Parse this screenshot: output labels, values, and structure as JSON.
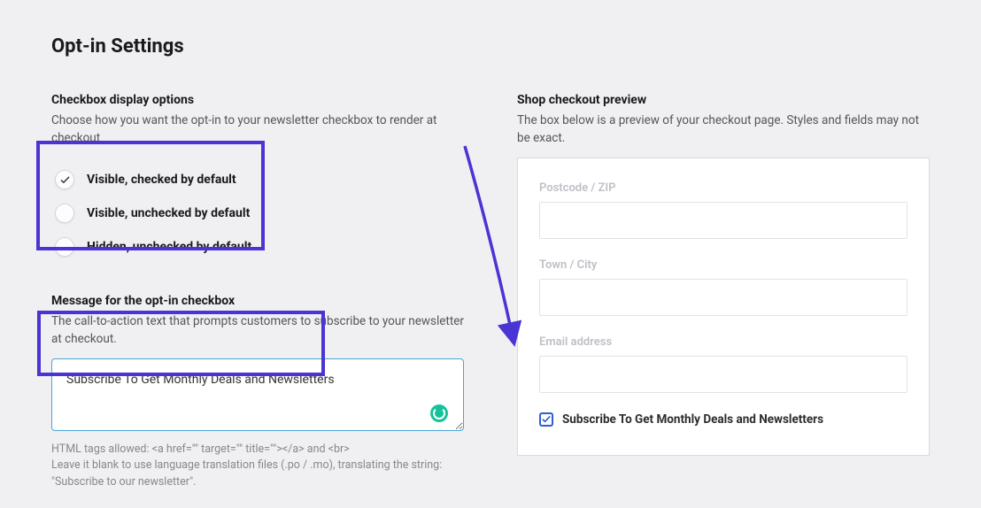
{
  "title": "Opt-in Settings",
  "left": {
    "checkbox_section": {
      "title": "Checkbox display options",
      "desc": "Choose how you want the opt-in to your newsletter checkbox to render at checkout",
      "options": [
        {
          "label": "Visible, checked by default",
          "checked": true
        },
        {
          "label": "Visible, unchecked by default",
          "checked": false
        },
        {
          "label": "Hidden, unchecked by default",
          "checked": false
        }
      ]
    },
    "message_section": {
      "title": "Message for the opt-in checkbox",
      "desc": "The call-to-action text that prompts customers to subscribe to your newsletter at checkout.",
      "value": "Subscribe To Get Monthly Deals and Newsletters",
      "help": "HTML tags allowed: <a href=\"\" target=\"\" title=\"\"></a> and <br>\nLeave it blank to use language translation files (.po / .mo), translating the string: \"Subscribe to our newsletter\"."
    }
  },
  "right": {
    "title": "Shop checkout preview",
    "desc": "The box below is a preview of your checkout page. Styles and fields may not be exact.",
    "fields": {
      "postcode": "Postcode / ZIP",
      "town": "Town / City",
      "email": "Email address"
    },
    "subscribe_label": "Subscribe To Get Monthly Deals and Newsletters"
  }
}
